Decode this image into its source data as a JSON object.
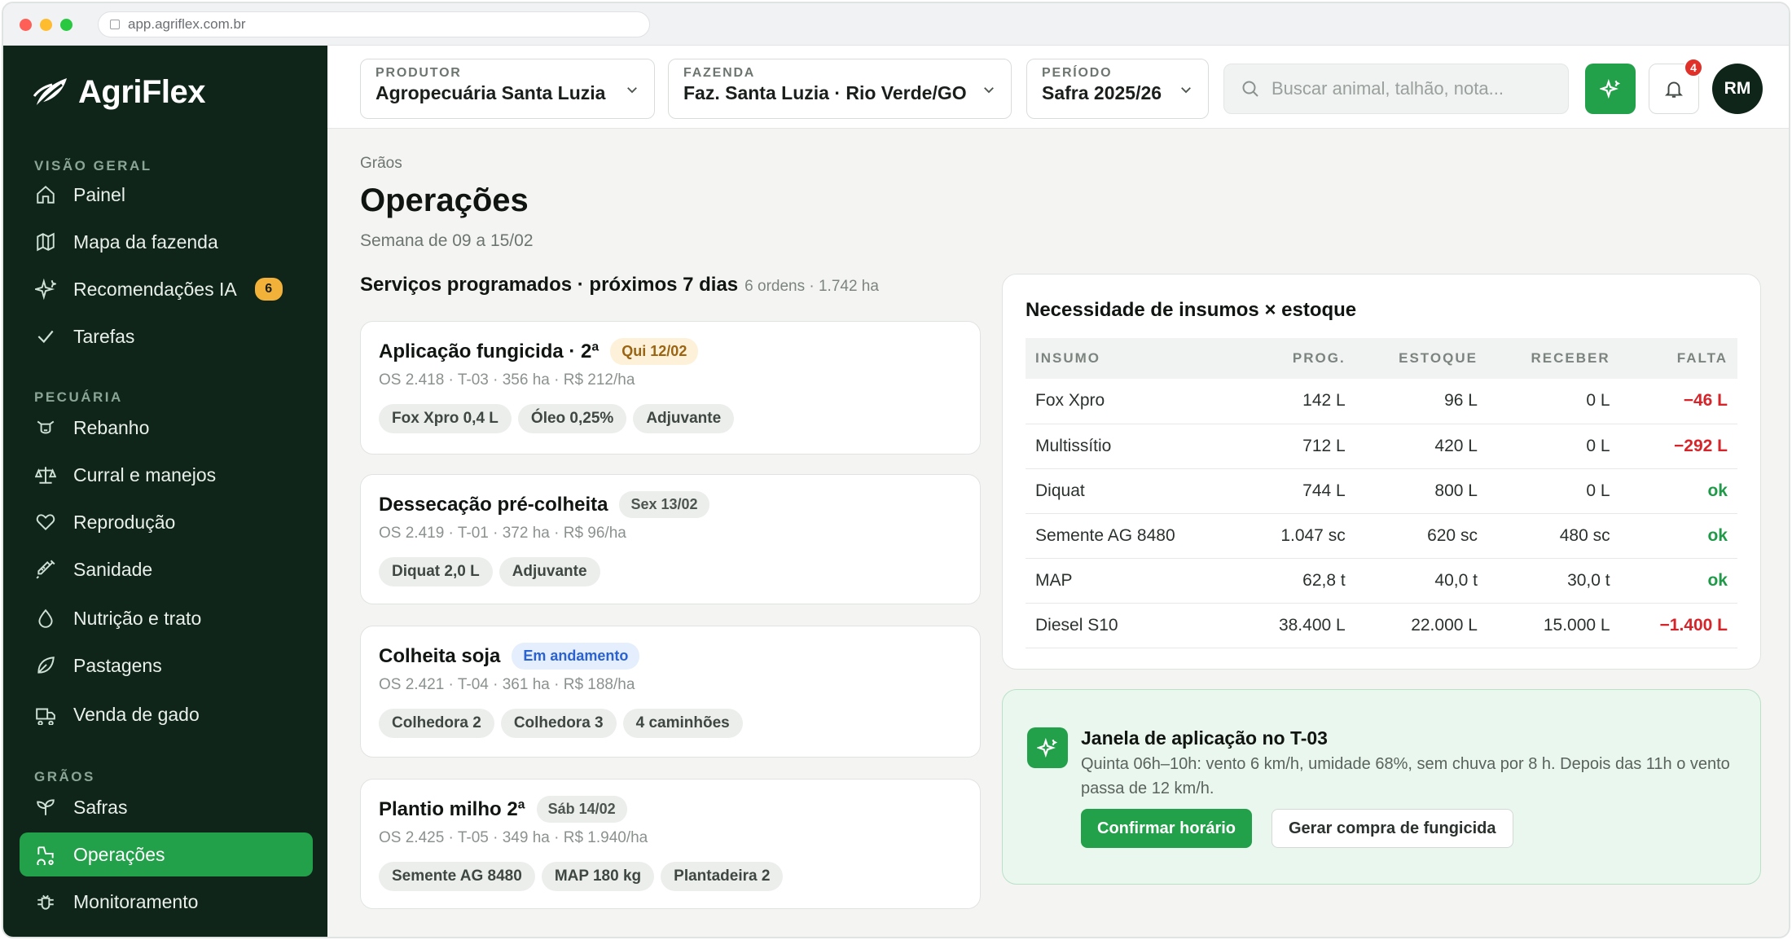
{
  "browser": {
    "url": "app.agriflex.com.br"
  },
  "brand": {
    "name": "AgriFlex"
  },
  "sidebar": {
    "sections": {
      "overview": "VISÃO GERAL",
      "livestock": "PECUÁRIA",
      "grains": "GRÃOS"
    },
    "items": {
      "painel": "Painel",
      "mapa": "Mapa da fazenda",
      "recomendacoes": "Recomendações IA",
      "recomendacoes_badge": "6",
      "tarefas": "Tarefas",
      "rebanho": "Rebanho",
      "curral": "Curral e manejos",
      "reproducao": "Reprodução",
      "sanidade": "Sanidade",
      "nutricao": "Nutrição e trato",
      "pastagens": "Pastagens",
      "venda": "Venda de gado",
      "safras": "Safras",
      "operacoes": "Operações",
      "monitoramento": "Monitoramento"
    },
    "active": "operacoes"
  },
  "topbar": {
    "produtor": {
      "label": "PRODUTOR",
      "value": "Agropecuária Santa Luzia"
    },
    "fazenda": {
      "label": "FAZENDA",
      "value": "Faz. Santa Luzia · Rio Verde/GO"
    },
    "periodo": {
      "label": "PERÍODO",
      "value": "Safra 2025/26"
    },
    "search_placeholder": "Buscar animal, talhão, nota...",
    "notifications": "4",
    "avatar": "RM"
  },
  "page": {
    "breadcrumb": "Grãos",
    "title": "Operações",
    "subtitle": "Semana de 09 a 15/02"
  },
  "services": {
    "title": "Serviços programados · próximos 7 dias",
    "meta": "6 ordens · 1.742 ha",
    "cards": [
      {
        "title": "Aplicação fungicida · 2ª",
        "tag": "Qui 12/02",
        "os": "OS 2.418 · T-03 · 356 ha · R$ 212/ha",
        "chips": [
          "Fox Xpro 0,4 L",
          "Óleo 0,25%",
          "Adjuvante"
        ]
      },
      {
        "title": "Dessecação pré-colheita",
        "tag": "Sex 13/02",
        "os": "OS 2.419 · T-01 · 372 ha · R$ 96/ha",
        "chips": [
          "Diquat 2,0 L",
          "Adjuvante"
        ]
      },
      {
        "title": "Colheita soja",
        "tag": "Em andamento",
        "os": "OS 2.421 · T-04 · 361 ha · R$ 188/ha",
        "chips": [
          "Colhedora 2",
          "Colhedora 3",
          "4 caminhões"
        ]
      },
      {
        "title": "Plantio milho 2ª",
        "tag": "Sáb 14/02",
        "os": "OS 2.425 · T-05 · 349 ha · R$ 1.940/ha",
        "chips": [
          "Semente AG 8480",
          "MAP 180 kg",
          "Plantadeira 2"
        ]
      }
    ]
  },
  "inputs_panel": {
    "title": "Necessidade de insumos × estoque",
    "headers": [
      "INSUMO",
      "PROG.",
      "ESTOQUE",
      "RECEBER",
      "FALTA"
    ],
    "rows": [
      [
        "Fox Xpro",
        "142 L",
        "96 L",
        "0 L",
        "−46 L"
      ],
      [
        "Multissítio",
        "712 L",
        "420 L",
        "0 L",
        "−292 L"
      ],
      [
        "Diquat",
        "744 L",
        "800 L",
        "0 L",
        "ok"
      ],
      [
        "Semente AG 8480",
        "1.047 sc",
        "620 sc",
        "480 sc",
        "ok"
      ],
      [
        "MAP",
        "62,8 t",
        "40,0 t",
        "30,0 t",
        "ok"
      ],
      [
        "Diesel S10",
        "38.400 L",
        "22.000 L",
        "15.000 L",
        "−1.400 L"
      ]
    ]
  },
  "ai_suggestion": {
    "title": "Janela de aplicação no T-03",
    "description": "Quinta 06h–10h: vento 6 km/h, umidade 68%, sem chuva por 8 h. Depois das 11h o vento passa de 12 km/h.",
    "primary": "Confirmar horário",
    "secondary": "Gerar compra de fungicida"
  },
  "colors": {
    "accent": "#23a04a",
    "sidebar": "#0f2519",
    "danger": "#d5242a"
  }
}
